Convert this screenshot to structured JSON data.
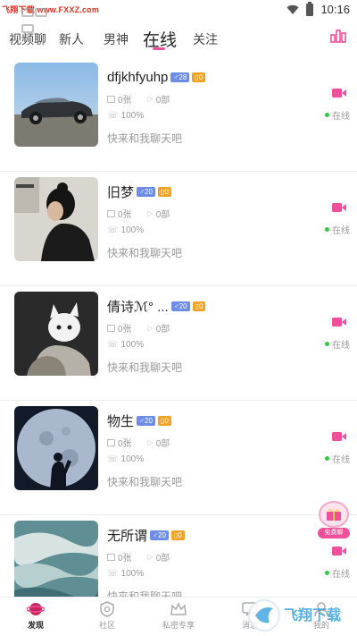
{
  "status_bar": {
    "watermark_text": "飞翔下载 www.FXXZ.com",
    "time": "10:16"
  },
  "tabs": [
    {
      "label": "视频聊",
      "active": false
    },
    {
      "label": "新人",
      "active": false
    },
    {
      "label": "男神",
      "active": false
    },
    {
      "label": "在线",
      "active": true
    },
    {
      "label": "关注",
      "active": false
    }
  ],
  "users": [
    {
      "name": "dfjkhfyuhp",
      "gender_badge": "♂28",
      "level_badge": "0",
      "photos": "0张",
      "videos": "0部",
      "reply_rate": "100%",
      "invite": "快来和我聊天吧",
      "status": "在线"
    },
    {
      "name": "旧梦",
      "gender_badge": "♂20",
      "level_badge": "0",
      "photos": "0张",
      "videos": "0部",
      "reply_rate": "100%",
      "invite": "快来和我聊天吧",
      "status": "在线"
    },
    {
      "name": "倩诗ℳ°  ...",
      "gender_badge": "♂20",
      "level_badge": "0",
      "photos": "0张",
      "videos": "0部",
      "reply_rate": "100%",
      "invite": "快来和我聊天吧",
      "status": "在线"
    },
    {
      "name": "物生",
      "gender_badge": "♂20",
      "level_badge": "0",
      "photos": "0张",
      "videos": "0部",
      "reply_rate": "100%",
      "invite": "快来和我聊天吧",
      "status": "在线"
    },
    {
      "name": "无所谓",
      "gender_badge": "♂20",
      "level_badge": "0",
      "photos": "0张",
      "videos": "0部",
      "reply_rate": "100%",
      "invite": "快来和我聊天吧",
      "status": "在线"
    }
  ],
  "gift_float": {
    "label": "免费聊"
  },
  "bottom_nav": [
    {
      "label": "发现",
      "active": true
    },
    {
      "label": "社区",
      "active": false
    },
    {
      "label": "私密专享",
      "active": false
    },
    {
      "label": "消息",
      "active": false
    },
    {
      "label": "我的",
      "active": false
    }
  ],
  "brand_watermark": {
    "text": "飞翔下载"
  },
  "colors": {
    "accent": "#f0509a",
    "online": "#2ecc40",
    "gender_badge": "#6d8ee8",
    "level_badge": "#f2a225"
  },
  "icons": {
    "tab_right": "bar-chart-icon",
    "call": "video-camera-icon",
    "nav": [
      "planet-icon",
      "shield-icon",
      "crown-icon",
      "message-icon",
      "person-icon"
    ]
  }
}
